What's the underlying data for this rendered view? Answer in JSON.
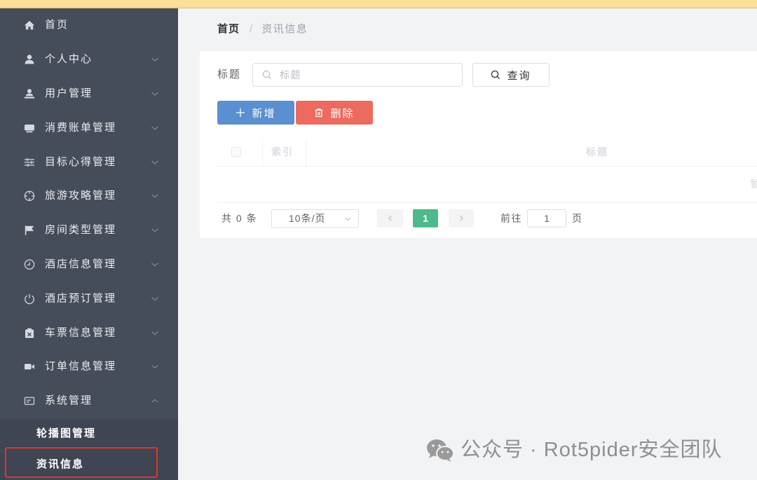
{
  "colors": {
    "sidebar_bg": "#454c5a",
    "submenu_bg": "#3f4552",
    "primary": "#5a8fd0",
    "danger": "#ec6a5e",
    "success": "#4fb98c",
    "top_bar": "#fadf99",
    "highlight": "#e0352b"
  },
  "sidebar": {
    "items": [
      {
        "label": "首页",
        "icon": "home-icon"
      },
      {
        "label": "个人中心",
        "icon": "person-icon",
        "expanded": false
      },
      {
        "label": "用户管理",
        "icon": "user-admin-icon",
        "expanded": false
      },
      {
        "label": "消费账单管理",
        "icon": "bill-icon",
        "expanded": false
      },
      {
        "label": "目标心得管理",
        "icon": "sliders-icon",
        "expanded": false
      },
      {
        "label": "旅游攻略管理",
        "icon": "compass-icon",
        "expanded": false
      },
      {
        "label": "房间类型管理",
        "icon": "flag-icon",
        "expanded": false
      },
      {
        "label": "酒店信息管理",
        "icon": "clock-icon",
        "expanded": false
      },
      {
        "label": "酒店预订管理",
        "icon": "power-icon",
        "expanded": false
      },
      {
        "label": "车票信息管理",
        "icon": "ticket-icon",
        "expanded": false
      },
      {
        "label": "订单信息管理",
        "icon": "video-camera-icon",
        "expanded": false
      },
      {
        "label": "系统管理",
        "icon": "message-box-icon",
        "expanded": true
      }
    ],
    "submenu": [
      {
        "label": "轮播图管理"
      },
      {
        "label": "资讯信息",
        "active": true
      }
    ]
  },
  "breadcrumb": {
    "home": "首页",
    "separator": "/",
    "current": "资讯信息"
  },
  "search": {
    "label": "标题",
    "placeholder": "标题",
    "button_label": "查询"
  },
  "actions": {
    "add_label": "新增",
    "delete_label": "删除"
  },
  "table": {
    "columns": [
      "索引",
      "标题"
    ],
    "rows": [],
    "empty_text": "暂"
  },
  "pagination": {
    "total_text": "共 0 条",
    "page_size": "10条/页",
    "current_page": "1",
    "goto_label": "前往",
    "goto_value": "1",
    "page_suffix": "页"
  },
  "watermark": {
    "text": "公众号 · Rot5pider安全团队"
  }
}
